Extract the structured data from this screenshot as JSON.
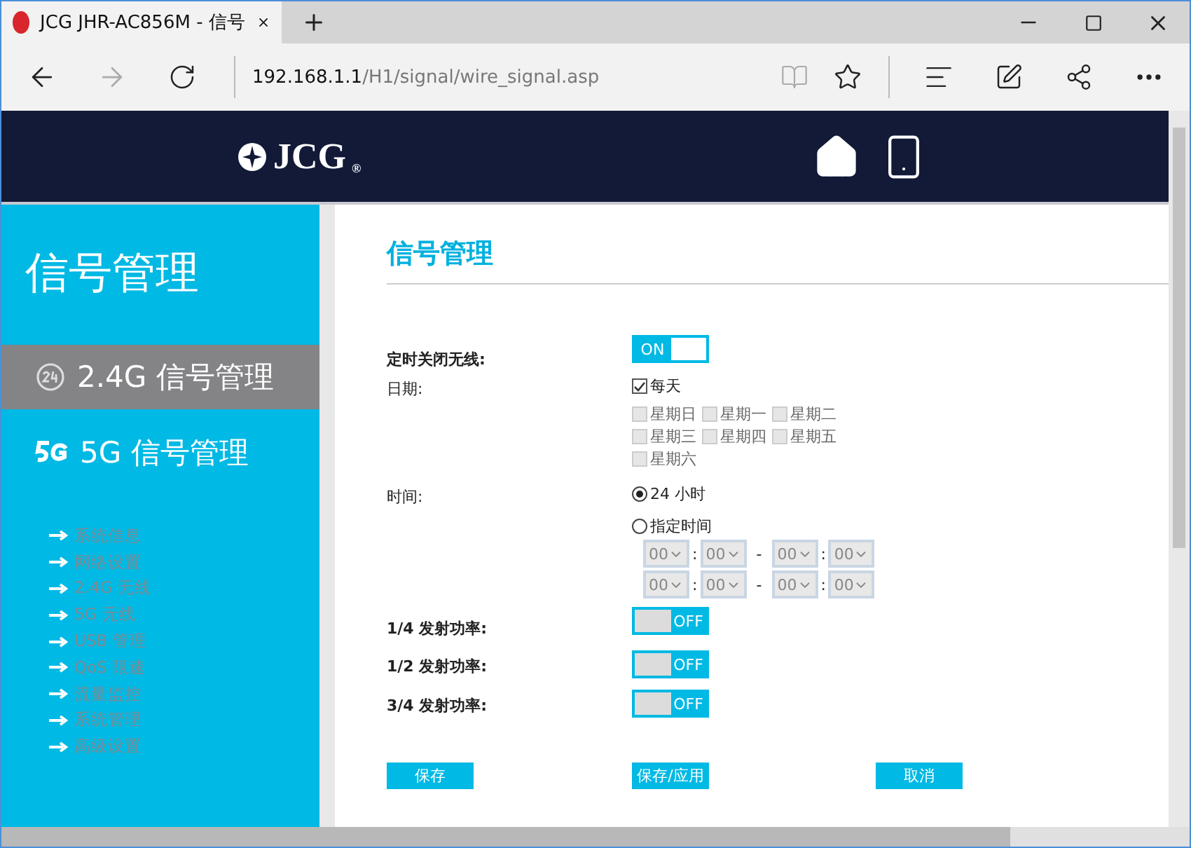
{
  "browser": {
    "tab_title": "JCG JHR-AC856M - 信号",
    "address_host": "192.168.1.1",
    "address_path": "/H1/signal/wire_signal.asp"
  },
  "header": {
    "logo": "JCG",
    "logo_mark": "®"
  },
  "sidebar": {
    "title": "信号管理",
    "items": [
      {
        "label": "2.4G 信号管理",
        "kind": "band24",
        "selected": true
      },
      {
        "label": "5G 信号管理",
        "kind": "band5",
        "selected": false
      }
    ],
    "links": [
      "系统信息",
      "网络设置",
      "2.4G 无线",
      "5G 无线",
      "USB 管理",
      "QoS 限速",
      "流量监控",
      "系统管理",
      "高级设置"
    ]
  },
  "main": {
    "title": "信号管理",
    "schedule": {
      "label": "定时关闭无线:",
      "on": true,
      "switch_text": "ON"
    },
    "date": {
      "label": "日期:",
      "everyday": {
        "label": "每天",
        "checked": true
      },
      "days": [
        {
          "label": "星期日",
          "checked": false,
          "disabled": true
        },
        {
          "label": "星期一",
          "checked": false,
          "disabled": true
        },
        {
          "label": "星期二",
          "checked": false,
          "disabled": true
        },
        {
          "label": "星期三",
          "checked": false,
          "disabled": true
        },
        {
          "label": "星期四",
          "checked": false,
          "disabled": true
        },
        {
          "label": "星期五",
          "checked": false,
          "disabled": true
        },
        {
          "label": "星期六",
          "checked": false,
          "disabled": true
        }
      ]
    },
    "time": {
      "label": "时间:",
      "options": [
        {
          "label": "24 小时",
          "selected": true
        },
        {
          "label": "指定时间",
          "selected": false
        }
      ],
      "ranges": [
        {
          "start_hour": "00",
          "start_minute": "00",
          "end_hour": "00",
          "end_minute": "00"
        },
        {
          "start_hour": "00",
          "start_minute": "00",
          "end_hour": "00",
          "end_minute": "00"
        }
      ],
      "separator": ":",
      "dash": "-"
    },
    "power": [
      {
        "label": "1/4 发射功率:",
        "on": false,
        "switch_text": "OFF"
      },
      {
        "label": "1/2 发射功率:",
        "on": false,
        "switch_text": "OFF"
      },
      {
        "label": "3/4 发射功率:",
        "on": false,
        "switch_text": "OFF"
      }
    ],
    "buttons": [
      "保存",
      "保存/应用",
      "取消"
    ]
  }
}
